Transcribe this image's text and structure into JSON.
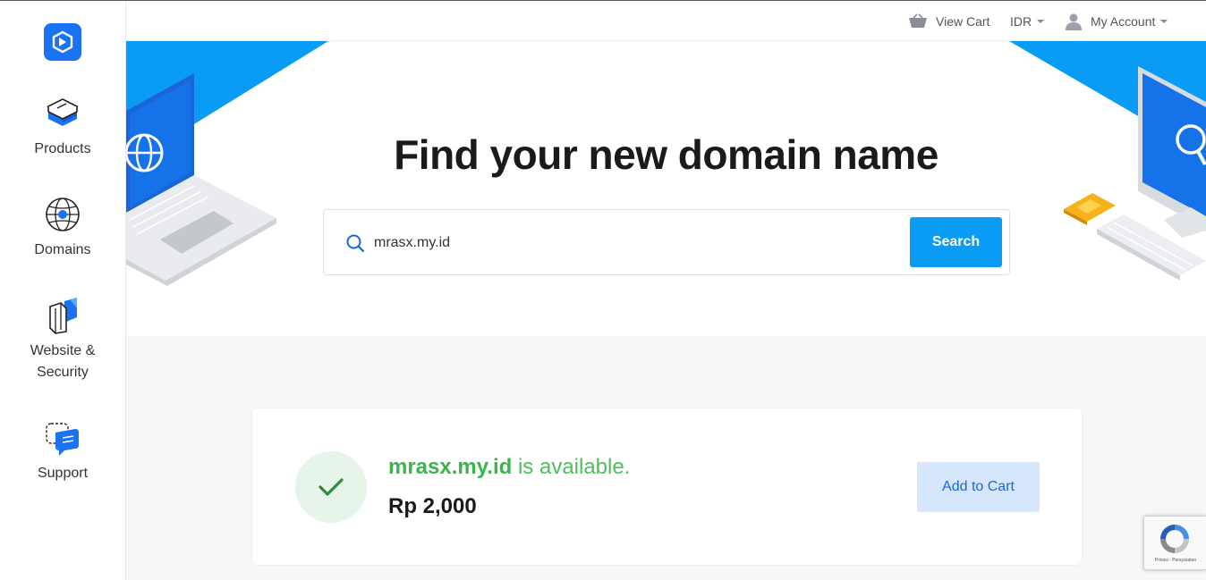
{
  "sidebar": {
    "logo": "brand-logo-icon",
    "items": [
      {
        "label": "Products",
        "icon": "server-layers-icon"
      },
      {
        "label": "Domains",
        "icon": "globe-icon"
      },
      {
        "label": "Website & Security",
        "icon": "shield-book-icon"
      },
      {
        "label": "Support",
        "icon": "chat-bubble-icon"
      }
    ]
  },
  "topbar": {
    "view_cart": "View Cart",
    "currency": "IDR",
    "account": "My Account"
  },
  "hero": {
    "title": "Find your new domain name"
  },
  "search": {
    "value": "mrasx.my.id",
    "button": "Search"
  },
  "result": {
    "domain": "mrasx.my.id",
    "status_text": " is available.",
    "price": "Rp 2,000",
    "add_to_cart": "Add to Cart"
  },
  "recaptcha": {
    "footer": "Privasi - Persyaratan"
  },
  "colors": {
    "accent_blue": "#0a9cf5",
    "brand_blue": "#1a73f5",
    "available_green": "#3ab54a"
  }
}
